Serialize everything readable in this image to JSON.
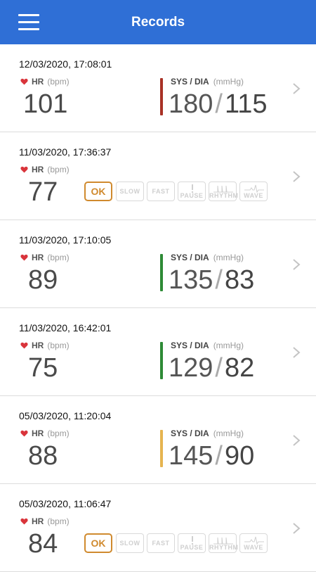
{
  "header": {
    "title": "Records",
    "menu_icon": "hamburger-menu-icon",
    "color": "#2f6fd6"
  },
  "labels": {
    "hr": "HR",
    "hr_unit": "(bpm)",
    "bp": "SYS / DIA",
    "bp_unit": "(mmHg)",
    "bp_sep": "/"
  },
  "badges": {
    "ok": "OK",
    "slow": "SLOW",
    "fast": "FAST",
    "pause": "PAUSE",
    "rhythm": "RHYTHM",
    "wave": "WAVE"
  },
  "records": [
    {
      "time": "12/03/2020, 17:08:01",
      "hr": "101",
      "sys": "180",
      "dia": "115",
      "bp_color": "#a93226"
    },
    {
      "time": "11/03/2020, 17:36:37",
      "hr": "77",
      "ecg": "OK"
    },
    {
      "time": "11/03/2020, 17:10:05",
      "hr": "89",
      "sys": "135",
      "dia": "83",
      "bp_color": "#2e8b36"
    },
    {
      "time": "11/03/2020, 16:42:01",
      "hr": "75",
      "sys": "129",
      "dia": "82",
      "bp_color": "#2e8b36"
    },
    {
      "time": "05/03/2020, 11:20:04",
      "hr": "88",
      "sys": "145",
      "dia": "90",
      "bp_color": "#e6b450"
    },
    {
      "time": "05/03/2020, 11:06:47",
      "hr": "84",
      "ecg": "OK"
    }
  ]
}
